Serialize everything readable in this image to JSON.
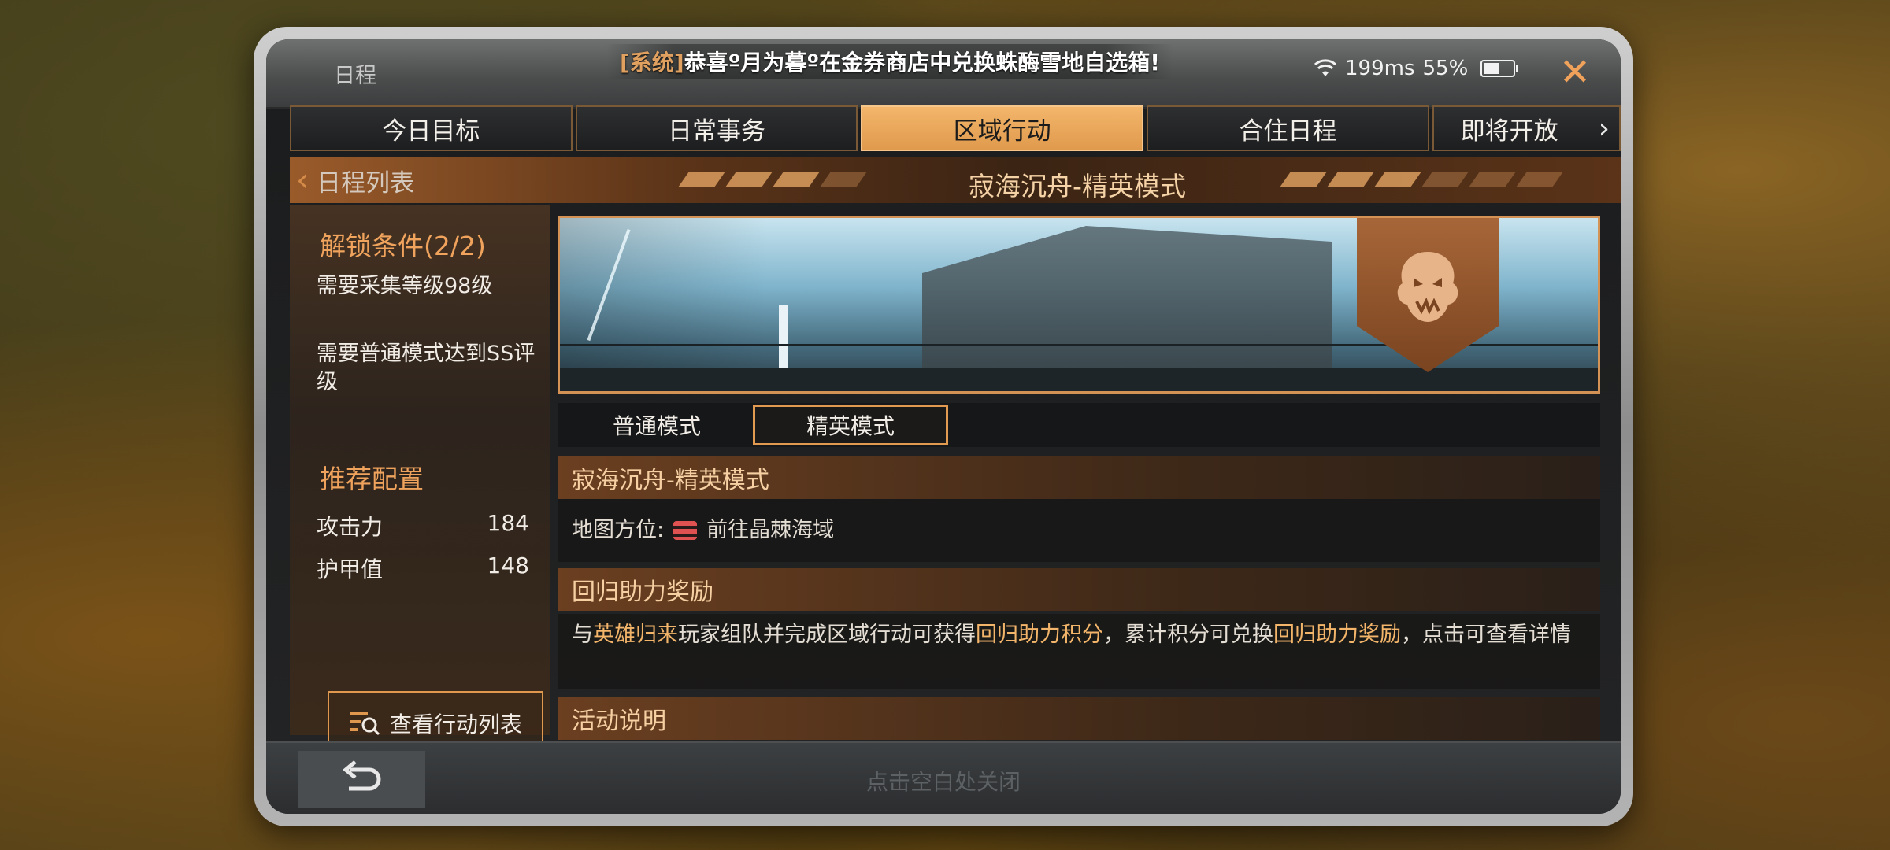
{
  "header": {
    "schedule_label": "日程",
    "announcement_tag": "[系统]",
    "announcement_text": "恭喜º月为暮º在金券商店中兑换蛛酶雪地自选箱!",
    "ping": "199ms",
    "battery": "55%",
    "battery_level": 0.55,
    "close_icon": "close-icon"
  },
  "tabs": [
    {
      "label": "今日目标"
    },
    {
      "label": "日常事务"
    },
    {
      "label": "区域行动",
      "active": true
    },
    {
      "label": "合住日程"
    },
    {
      "label": "即将开放"
    }
  ],
  "title_strip": {
    "back_label": "日程列表",
    "title": "寂海沉舟-精英模式"
  },
  "left_panel": {
    "unlock_title": "解锁条件(2/2)",
    "conditions": [
      "需要采集等级98级",
      "需要普通模式达到SS评级"
    ],
    "recommend_title": "推荐配置",
    "stats": [
      {
        "label": "攻击力",
        "value": "184"
      },
      {
        "label": "护甲值",
        "value": "148"
      }
    ],
    "action_button": "查看行动列表"
  },
  "modes": [
    {
      "label": "普通模式"
    },
    {
      "label": "精英模式",
      "active": true
    }
  ],
  "details": {
    "section_title": "寂海沉舟-精英模式",
    "location_label": "地图方位:",
    "location_value": "前往晶棘海域",
    "reward_title": "回归助力奖励",
    "reward_text": {
      "p1": "与",
      "h1": "英雄归来",
      "p2": "玩家组队并完成区域行动可获得",
      "h2": "回归助力积分",
      "p3": "，累计积分可兑换",
      "h3": "回归助力奖励",
      "p4": "，点击可查看详情"
    },
    "activity_title": "活动说明"
  },
  "bottom": {
    "hint": "点击空白处关闭"
  },
  "colors": {
    "accent": "#e29a50",
    "highlight": "#f3b56a",
    "active_tab": "#f3b66b"
  }
}
